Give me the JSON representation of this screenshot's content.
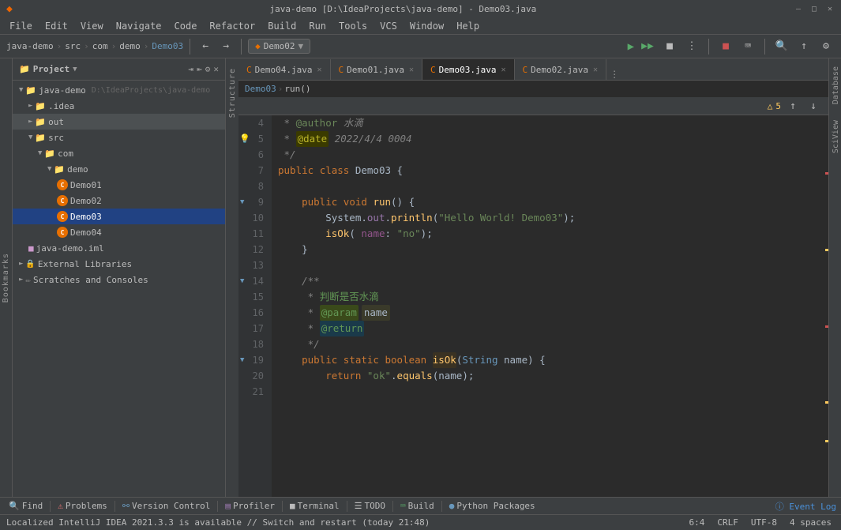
{
  "titlebar": {
    "title": "java-demo [D:\\IdeaProjects\\java-demo] - Demo03.java",
    "project": "java-demo"
  },
  "menubar": {
    "items": [
      "File",
      "Edit",
      "View",
      "Navigate",
      "Code",
      "Refactor",
      "Build",
      "Run",
      "Tools",
      "VCS",
      "Window",
      "Help"
    ]
  },
  "toolbar": {
    "breadcrumb": [
      "java-demo",
      "src",
      "com",
      "demo",
      "Demo03"
    ],
    "run_config": "Demo02",
    "icons": [
      "back",
      "forward",
      "run",
      "debug",
      "run-coverage",
      "stop",
      "build",
      "search",
      "update",
      "settings"
    ]
  },
  "project_panel": {
    "title": "Project",
    "tree": [
      {
        "label": "java-demo",
        "path": "D:\\IdeaProjects\\java-demo",
        "type": "root",
        "indent": 0,
        "expanded": true
      },
      {
        "label": ".idea",
        "type": "folder",
        "indent": 1,
        "expanded": false
      },
      {
        "label": "out",
        "type": "folder",
        "indent": 1,
        "expanded": false,
        "highlighted": true
      },
      {
        "label": "src",
        "type": "folder",
        "indent": 1,
        "expanded": true
      },
      {
        "label": "com",
        "type": "folder",
        "indent": 2,
        "expanded": true
      },
      {
        "label": "demo",
        "type": "folder",
        "indent": 3,
        "expanded": true
      },
      {
        "label": "Demo01",
        "type": "java",
        "indent": 4
      },
      {
        "label": "Demo02",
        "type": "java",
        "indent": 4
      },
      {
        "label": "Demo03",
        "type": "java",
        "indent": 4,
        "selected": true
      },
      {
        "label": "Demo04",
        "type": "java",
        "indent": 4
      },
      {
        "label": "java-demo.iml",
        "type": "iml",
        "indent": 1
      },
      {
        "label": "External Libraries",
        "type": "ext",
        "indent": 0,
        "expanded": false
      },
      {
        "label": "Scratches and Consoles",
        "type": "ext2",
        "indent": 0,
        "expanded": false
      }
    ]
  },
  "editor": {
    "tabs": [
      {
        "label": "Demo04.java",
        "active": false,
        "icon": "java"
      },
      {
        "label": "Demo01.java",
        "active": false,
        "icon": "java"
      },
      {
        "label": "Demo03.java",
        "active": true,
        "icon": "java"
      },
      {
        "label": "Demo02.java",
        "active": false,
        "icon": "java"
      }
    ],
    "breadcrumb": [
      "Demo03",
      "run()"
    ],
    "warning_count": "5",
    "lines": [
      {
        "num": 4,
        "content": " * @author 水滴",
        "type": "comment"
      },
      {
        "num": 5,
        "content": " * @date 2022/4/4 0004",
        "type": "comment_anno",
        "has_bulb": true
      },
      {
        "num": 6,
        "content": " */",
        "type": "comment"
      },
      {
        "num": 7,
        "content": "public class Demo03 {",
        "type": "code"
      },
      {
        "num": 8,
        "content": "",
        "type": "empty"
      },
      {
        "num": 9,
        "content": "    public void run() {",
        "type": "code",
        "has_fold": true
      },
      {
        "num": 10,
        "content": "        System.out.println(\"Hello World! Demo03\");",
        "type": "code"
      },
      {
        "num": 11,
        "content": "        isOk( name: \"no\");",
        "type": "code"
      },
      {
        "num": 12,
        "content": "    }",
        "type": "code"
      },
      {
        "num": 13,
        "content": "",
        "type": "empty"
      },
      {
        "num": 14,
        "content": "    /**",
        "type": "comment",
        "has_fold": true
      },
      {
        "num": 15,
        "content": "     * 判断是否水滴",
        "type": "comment"
      },
      {
        "num": 16,
        "content": "     * @param name",
        "type": "comment_param"
      },
      {
        "num": 17,
        "content": "     * @return",
        "type": "comment_return"
      },
      {
        "num": 18,
        "content": "     */",
        "type": "comment"
      },
      {
        "num": 19,
        "content": "    public static boolean isOk(String name) {",
        "type": "code",
        "has_fold": true
      },
      {
        "num": 20,
        "content": "        return \"ok\".equals(name);",
        "type": "code"
      },
      {
        "num": 21,
        "content": "",
        "type": "empty"
      }
    ]
  },
  "bottom_toolbar": {
    "items": [
      {
        "label": "Find",
        "icon": "search"
      },
      {
        "label": "Problems",
        "icon": "warning"
      },
      {
        "label": "Version Control",
        "icon": "vcs"
      },
      {
        "label": "Profiler",
        "icon": "profiler"
      },
      {
        "label": "Terminal",
        "icon": "terminal"
      },
      {
        "label": "TODO",
        "icon": "todo"
      },
      {
        "label": "Build",
        "icon": "build"
      },
      {
        "label": "Python Packages",
        "icon": "python"
      }
    ]
  },
  "status_bar": {
    "message": "Localized IntelliJ IDEA 2021.3.3 is available // Switch and restart (today 21:48)",
    "position": "6:4",
    "line_ending": "CRLF",
    "encoding": "UTF-8",
    "indent": "4 spaces",
    "event_log": "Event Log"
  },
  "right_tabs": [
    {
      "label": "Database"
    },
    {
      "label": "SciView"
    }
  ]
}
